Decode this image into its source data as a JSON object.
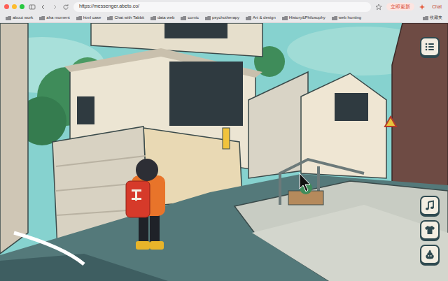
{
  "browser": {
    "url": "https://messenger.abeto.co/",
    "update_button": "立即更新",
    "chat_button": "Chat",
    "bookmarks": [
      "about work",
      "aha moment",
      "html case",
      "Chat with Tabbit",
      "data web",
      "comic",
      "psychotherapy",
      "Art & design",
      "History&Philosophy",
      "web hunting"
    ],
    "bookmarks_folder": "收藏夹"
  }
}
